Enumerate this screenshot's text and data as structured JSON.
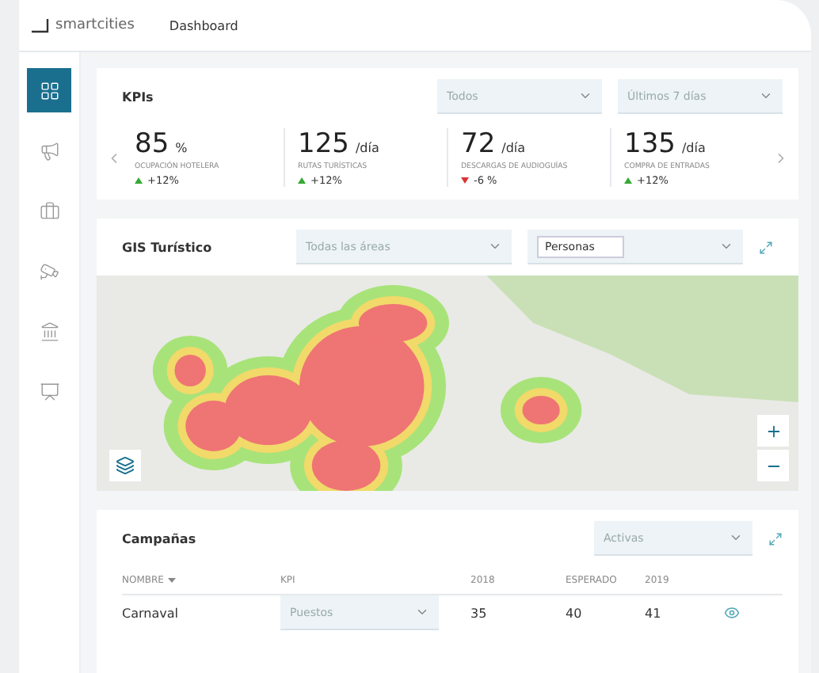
{
  "header": {
    "brand": "smartcities",
    "title": "Dashboard"
  },
  "sidebar": {
    "items": [
      {
        "selected": true
      },
      {
        "selected": false
      },
      {
        "selected": false
      },
      {
        "selected": false
      },
      {
        "selected": false
      },
      {
        "selected": false
      }
    ]
  },
  "kpis": {
    "title": "KPIs",
    "filters": [
      "Todos",
      "Últimos 7 días"
    ],
    "items": [
      {
        "value": "85",
        "unit": "%",
        "label": "OCUPACIÓN HOTELERA",
        "kind": "up",
        "change": "+12%"
      },
      {
        "value": "125",
        "unit": "/día",
        "label": "RUTAS TURÍSTICAS",
        "kind": "up",
        "change": "+12%"
      },
      {
        "value": "72",
        "unit": "/día",
        "label": "DESCARGAS DE AUDIOGUÍAS",
        "kind": "down",
        "change": "-6 %"
      },
      {
        "value": "135",
        "unit": "/día",
        "label": "COMPRA DE ENTRADAS",
        "kind": "up",
        "change": "+12%"
      }
    ]
  },
  "gis": {
    "title": "GIS Turístico",
    "area_filter": "Todas las áreas",
    "tag": "Personas"
  },
  "campaigns": {
    "title": "Campañas",
    "filter": "Activas",
    "columns": [
      "NOMBRE",
      "KPI",
      "2018",
      "ESPERADO",
      "2019"
    ],
    "rows": [
      {
        "cells": [
          "Carnaval",
          "Puestos",
          "35",
          "40",
          "41"
        ]
      }
    ]
  }
}
